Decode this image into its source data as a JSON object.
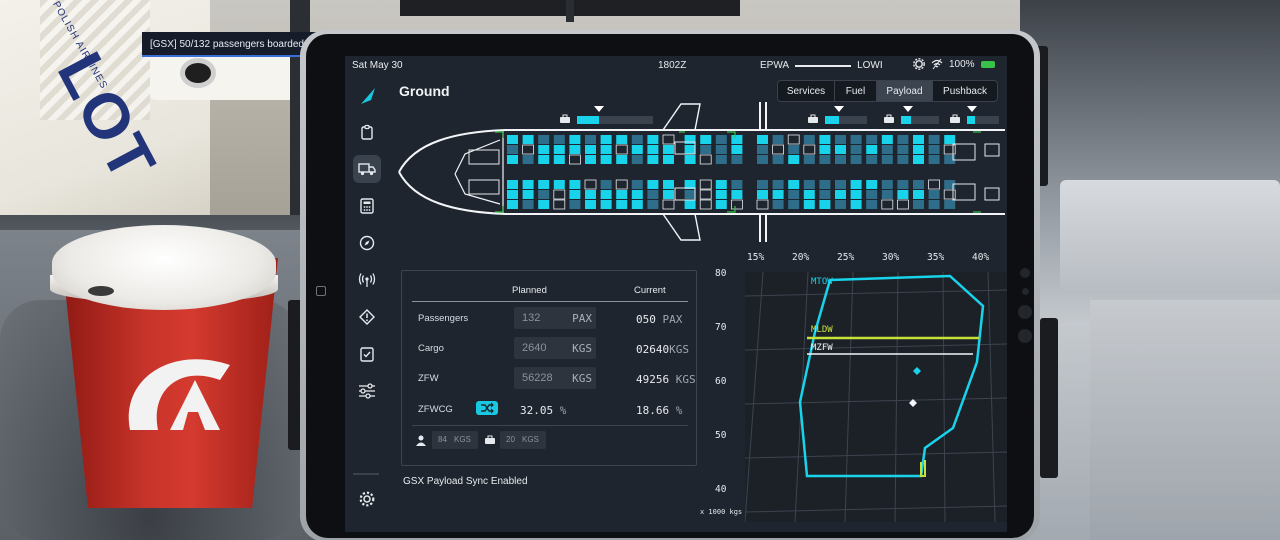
{
  "notification": {
    "text": "[GSX] 50/132 passengers boarded"
  },
  "statusbar": {
    "date": "Sat May 30",
    "time": "1802Z",
    "origin": "EPWA",
    "destination": "LOWI",
    "battery": "100%"
  },
  "header": {
    "title": "Ground"
  },
  "tabs": [
    {
      "label": "Services",
      "active": false
    },
    {
      "label": "Fuel",
      "active": false
    },
    {
      "label": "Payload",
      "active": true
    },
    {
      "label": "Pushback",
      "active": false
    }
  ],
  "nav": [
    {
      "icon": "logo-icon"
    },
    {
      "icon": "clipboard-icon"
    },
    {
      "icon": "truck-icon",
      "active": true
    },
    {
      "icon": "calculator-icon"
    },
    {
      "icon": "compass-icon"
    },
    {
      "icon": "radio-icon"
    },
    {
      "icon": "warning-icon"
    },
    {
      "icon": "checklist-icon"
    },
    {
      "icon": "sliders-icon"
    },
    {
      "icon": "gear-icon"
    }
  ],
  "weights": {
    "col_planned": "Planned",
    "col_current": "Current",
    "rows": [
      {
        "label": "Passengers",
        "planned": "132",
        "planned_unit": "PAX",
        "current": "050",
        "current_unit": "PAX"
      },
      {
        "label": "Cargo",
        "planned": "2640",
        "planned_unit": "KGS",
        "current": "02640",
        "current_unit": "KGS"
      },
      {
        "label": "ZFW",
        "planned": "56228",
        "planned_unit": "KGS",
        "current": "49256",
        "current_unit": "KGS"
      }
    ],
    "zfwcg": {
      "label": "ZFWCG",
      "planned": "32.05",
      "current": "18.66",
      "unit": "%"
    },
    "pax_weight": {
      "value": "84",
      "unit": "KGS"
    },
    "bag_weight": {
      "value": "20",
      "unit": "KGS"
    }
  },
  "sync_text": "GSX Payload Sync Enabled",
  "envelope": {
    "x_ticks": [
      "15%",
      "20%",
      "25%",
      "30%",
      "35%",
      "40%"
    ],
    "y_ticks": [
      "80",
      "70",
      "60",
      "50",
      "40"
    ],
    "unit": "x 1000 kgs",
    "lines": {
      "mtow": "MTOW",
      "mldw": "MLDW",
      "mzfw": "MZFW"
    }
  },
  "colors": {
    "accent": "#19d3ea",
    "mldw": "#c6e23a",
    "screen_bg": "#1f252e",
    "seat_empty": "#2f6e8a",
    "seat_occupied": "#19d3ea"
  }
}
